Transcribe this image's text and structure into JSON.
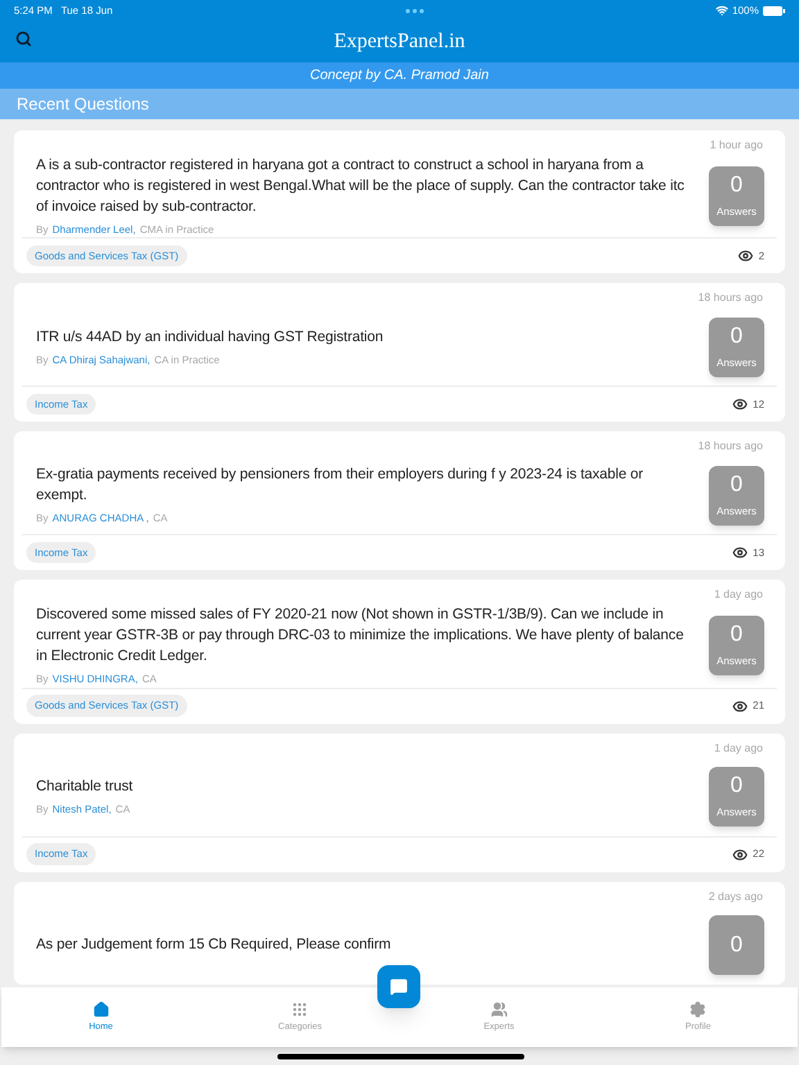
{
  "status_bar": {
    "time": "5:24 PM",
    "date": "Tue 18 Jun",
    "battery": "100%"
  },
  "header": {
    "title": "ExpertsPanel.in",
    "subtitle": "Concept by CA. Pramod Jain"
  },
  "section_title": "Recent Questions",
  "questions": [
    {
      "time": "1 hour ago",
      "text": "A is a sub-contractor registered in haryana got a contract to construct a school  in haryana from a contractor who is registered in west Bengal.What will be the place of supply. Can the contractor take itc of invoice raised by sub-contractor.",
      "by": "By",
      "author": "Dharmender Leel,",
      "role": "CMA in Practice",
      "answers": "0",
      "answers_label": "Answers",
      "category": "Goods and Services Tax (GST)",
      "views": "2"
    },
    {
      "time": "18 hours ago",
      "text": "ITR u/s 44AD by an individual having GST Registration",
      "by": "By",
      "author": "CA Dhiraj Sahajwani,",
      "role": "CA in Practice",
      "answers": "0",
      "answers_label": "Answers",
      "category": "Income Tax",
      "views": "12"
    },
    {
      "time": "18 hours ago",
      "text": "Ex-gratia payments received by pensioners from their employers during f y 2023-24 is taxable or exempt.",
      "by": "By",
      "author": "ANURAG CHADHA ,",
      "role": "CA",
      "answers": "0",
      "answers_label": "Answers",
      "category": "Income Tax",
      "views": "13"
    },
    {
      "time": "1 day ago",
      "text": "Discovered some missed sales of FY 2020-21 now (Not shown in GSTR-1/3B/9). Can we include in current year GSTR-3B or pay through DRC-03 to minimize the implications. We have plenty of balance in Electronic Credit Ledger.",
      "by": "By",
      "author": "VISHU DHINGRA,",
      "role": "CA",
      "answers": "0",
      "answers_label": "Answers",
      "category": "Goods and Services Tax (GST)",
      "views": "21"
    },
    {
      "time": "1 day ago",
      "text": "Charitable trust",
      "by": "By",
      "author": "Nitesh Patel,",
      "role": "CA",
      "answers": "0",
      "answers_label": "Answers",
      "category": "Income Tax",
      "views": "22"
    },
    {
      "time": "2 days ago",
      "text": "As per Judgement form 15 Cb Required, Please confirm",
      "answers": "0"
    }
  ],
  "tabs": [
    {
      "label": "Home",
      "kind": "home",
      "selected": true
    },
    {
      "label": "Categories",
      "kind": "grid",
      "selected": false
    },
    {
      "label": "Experts",
      "kind": "people",
      "selected": false
    },
    {
      "label": "Profile",
      "kind": "gear",
      "selected": false
    }
  ]
}
